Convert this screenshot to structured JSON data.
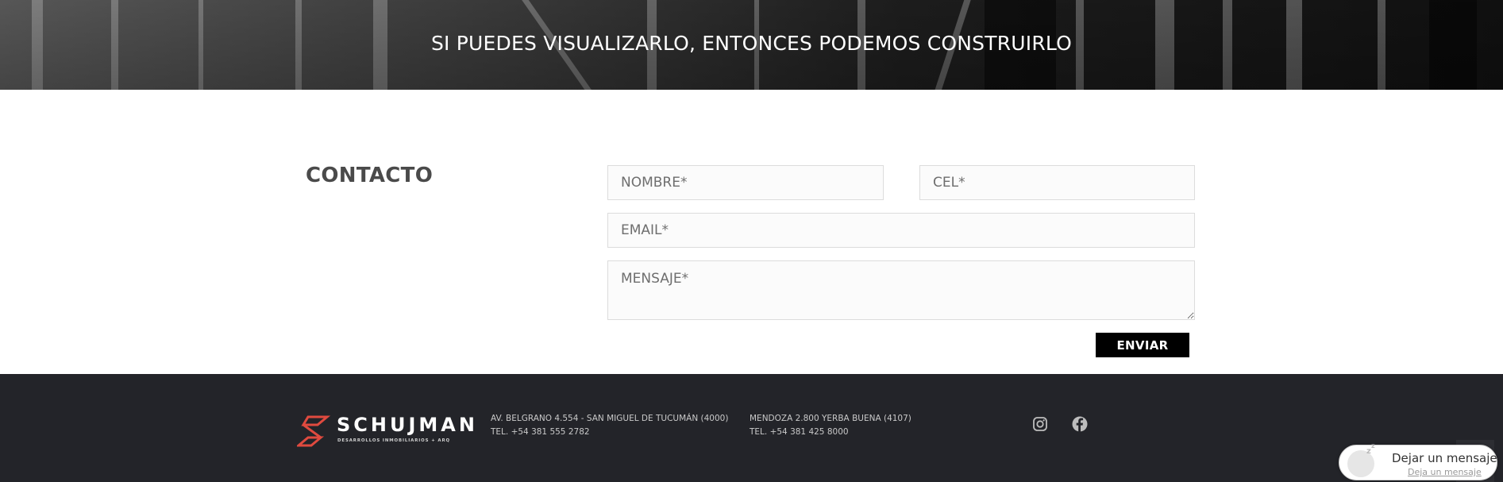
{
  "hero": {
    "title": "SI PUEDES VISUALIZARLO, ENTONCES PODEMOS CONSTRUIRLO"
  },
  "contact": {
    "heading": "CONTACTO",
    "name_placeholder": "NOMBRE*",
    "cel_placeholder": "CEL*",
    "email_placeholder": "EMAIL*",
    "message_placeholder": "MENSAJE*",
    "submit_label": "ENVIAR"
  },
  "footer": {
    "logo_name": "SCHUJMAN",
    "logo_tagline": "DESARROLLOS INMOBILIARIOS + ARQ",
    "offices": [
      {
        "address": "AV. BELGRANO 4.554 - SAN MIGUEL DE TUCUMÁN (4000)",
        "phone": "TEL. +54 381 555 2782"
      },
      {
        "address": "MENDOZA 2.800 YERBA BUENA (4107)",
        "phone": "TEL. +54 381 425 8000"
      }
    ],
    "social": [
      {
        "icon": "instagram-icon"
      },
      {
        "icon": "facebook-icon"
      }
    ]
  },
  "chat": {
    "title": "Dejar un mensaje",
    "link": "Deja un mensaje"
  },
  "colors": {
    "footer_bg": "#232429",
    "logo_accent": "#e04a3f",
    "button_bg": "#000000"
  }
}
